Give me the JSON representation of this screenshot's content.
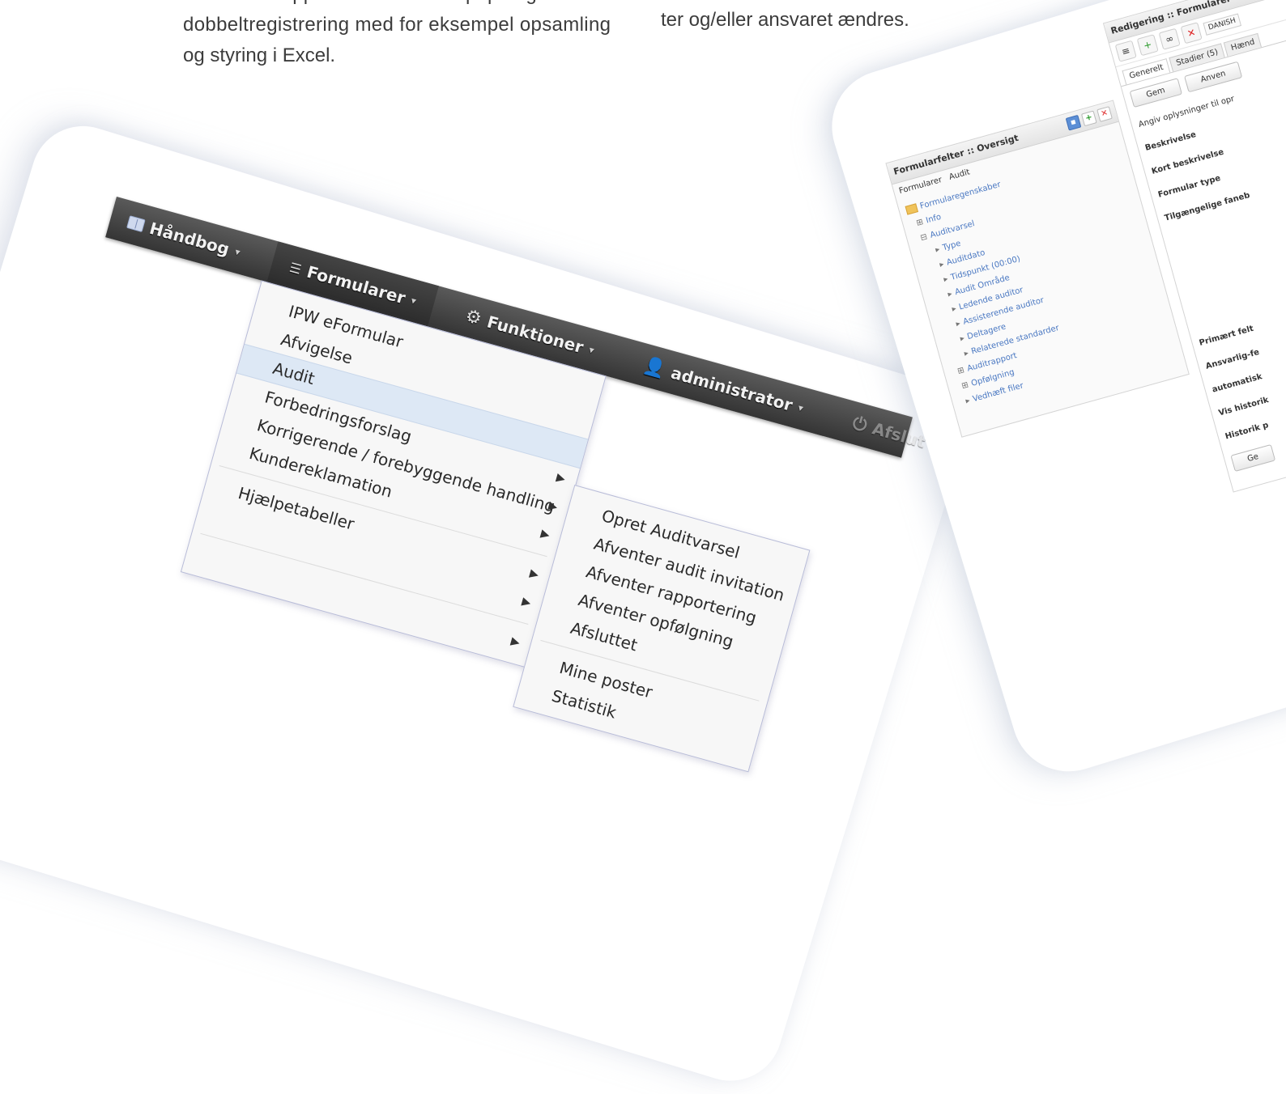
{
  "prose": {
    "left_lines": [
      "mular Pro slipper du dermed for papir og til tider",
      "dobbeltregistrering med for eksempel opsamling",
      "og styring i Excel."
    ],
    "right_line": "ter og/eller ansvaret ændres."
  },
  "navbar": {
    "items": [
      {
        "label": "Håndbog",
        "icon": "book-icon"
      },
      {
        "label": "Formularer",
        "icon": "list-icon"
      },
      {
        "label": "Funktioner",
        "icon": "gear-icon"
      },
      {
        "label": "administrator",
        "icon": "user-icon"
      },
      {
        "label": "Afslut",
        "icon": "power-icon"
      }
    ]
  },
  "menu_main": {
    "items": [
      {
        "label": "IPW eFormular",
        "arrow": false
      },
      {
        "label": "Afvigelse",
        "arrow": false
      },
      {
        "label": "Audit",
        "arrow": false,
        "highlight": true
      },
      {
        "label": "Forbedringsforslag",
        "arrow": false
      },
      {
        "label": "Korrigerende / forebyggende handling",
        "arrow": false
      },
      {
        "label": "Kundereklamation",
        "arrow": false
      },
      {
        "label": "Hjælpetabeller",
        "arrow": false
      }
    ]
  },
  "menu_sub": {
    "items": [
      "Opret Auditvarsel",
      "Afventer audit invitation",
      "Afventer rapportering",
      "Afventer opfølgning",
      "Afsluttet"
    ],
    "items_after_separator": [
      "Mine poster",
      "Statistik"
    ]
  },
  "overview_panel": {
    "title": "Formularfelter :: Oversigt",
    "filter_label": "Formularer",
    "filter_value": "Audit",
    "tree": {
      "root": "Formularegenskaber",
      "nodes": [
        {
          "label": "Info",
          "level": 1,
          "bullet": "⊞"
        },
        {
          "label": "Auditvarsel",
          "level": 1,
          "bullet": "⊟"
        },
        {
          "label": "Type",
          "level": 2,
          "bullet": "▸"
        },
        {
          "label": "Auditdato",
          "level": 2,
          "bullet": "▸"
        },
        {
          "label": "Tidspunkt (00:00)",
          "level": 2,
          "bullet": "▸"
        },
        {
          "label": "Audit Område",
          "level": 2,
          "bullet": "▸"
        },
        {
          "label": "Ledende auditor",
          "level": 2,
          "bullet": "▸"
        },
        {
          "label": "Assisterende auditor",
          "level": 2,
          "bullet": "▸"
        },
        {
          "label": "Deltagere",
          "level": 2,
          "bullet": "▸"
        },
        {
          "label": "Relaterede standarder",
          "level": 2,
          "bullet": "▸"
        },
        {
          "label": "Auditrapport",
          "level": 1,
          "bullet": "⊞"
        },
        {
          "label": "Opfølgning",
          "level": 1,
          "bullet": "⊞"
        },
        {
          "label": "Vedhæft filer",
          "level": 1,
          "bullet": "▸"
        }
      ]
    }
  },
  "edit_panel": {
    "title": "Redigering :: Formularer :: Audi",
    "language": "DANISH",
    "tabs": [
      "Generelt",
      "Stadier (5)",
      "Hænd"
    ],
    "save_label": "Gem",
    "apply_label": "Anven",
    "intro": "Angiv oplysninger til opr",
    "fields": [
      "Beskrivelse",
      "Kort beskrivelse",
      "Formular type",
      "Tilgængelige faneb"
    ],
    "fields_bottom": [
      "Primært felt",
      "Ansvarlig-fe",
      "automatisk",
      "Vis historik",
      "Historik p"
    ],
    "bottom_button": "Ge"
  }
}
